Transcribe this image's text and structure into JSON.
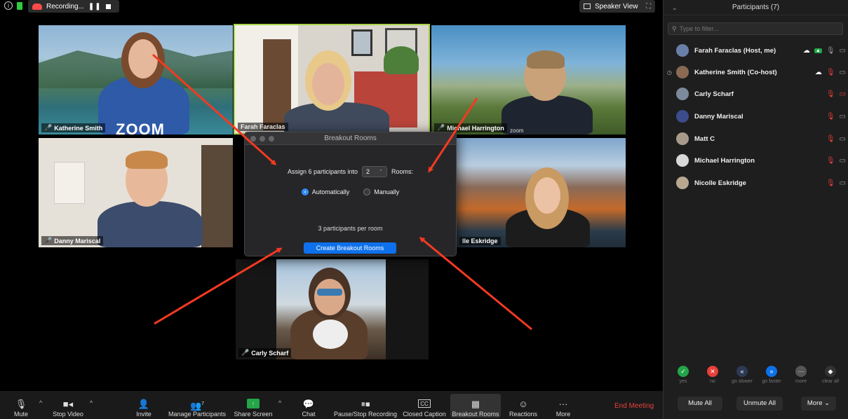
{
  "topbar": {
    "recording_label": "Recording...",
    "pause_glyph": "❚❚",
    "speaker_view_label": "Speaker View"
  },
  "tiles": [
    {
      "name": "Katherine Smith"
    },
    {
      "name": "Farah Faraclas"
    },
    {
      "name": "Michael Harrington"
    },
    {
      "name": "Danny Mariscal"
    },
    {
      "name": "lle Eskridge"
    },
    {
      "name": "Carly Scharf"
    }
  ],
  "tile_watermarks": {
    "tile0": "ZOOM",
    "tile2": "zoom"
  },
  "dialog": {
    "title": "Breakout Rooms",
    "assign_prefix": "Assign 6 participants into",
    "room_count": "2",
    "rooms_label": "Rooms:",
    "option_auto": "Automatically",
    "option_manual": "Manually",
    "per_room_text": "3 participants per room",
    "create_button": "Create Breakout Rooms"
  },
  "toolbar": {
    "mute": "Mute",
    "stop_video": "Stop Video",
    "invite": "Invite",
    "manage_participants": "Manage Participants",
    "participant_count": "7",
    "share_screen": "Share Screen",
    "chat": "Chat",
    "pause_stop_recording": "Pause/Stop Recording",
    "closed_caption": "Closed Caption",
    "cc_glyph": "CC",
    "breakout_rooms": "Breakout Rooms",
    "reactions": "Reactions",
    "more": "More",
    "end_meeting": "End Meeting"
  },
  "panel": {
    "title": "Participants (7)",
    "filter_placeholder": "Type to filter...",
    "participants": [
      {
        "name": "Farah Faraclas (Host, me)"
      },
      {
        "name": "Katherine Smith (Co-host)"
      },
      {
        "name": "Carly Scharf"
      },
      {
        "name": "Danny Mariscal"
      },
      {
        "name": "Matt C"
      },
      {
        "name": "Michael Harrington"
      },
      {
        "name": "Nicolle Eskridge"
      }
    ],
    "reactions": [
      {
        "label": "yes",
        "color": "#23a548"
      },
      {
        "label": "no",
        "color": "#e8403b"
      },
      {
        "label": "go slower",
        "color": "#2d3a55"
      },
      {
        "label": "go faster",
        "color": "#0e71eb"
      },
      {
        "label": "more",
        "color": "#555555"
      },
      {
        "label": "clear all",
        "color": "#333333"
      }
    ],
    "mute_all": "Mute All",
    "unmute_all": "Unmute All",
    "more": "More ⌄"
  },
  "colors": {
    "accent": "#0e71eb",
    "danger": "#e8403b",
    "arrow": "#f23a22"
  }
}
